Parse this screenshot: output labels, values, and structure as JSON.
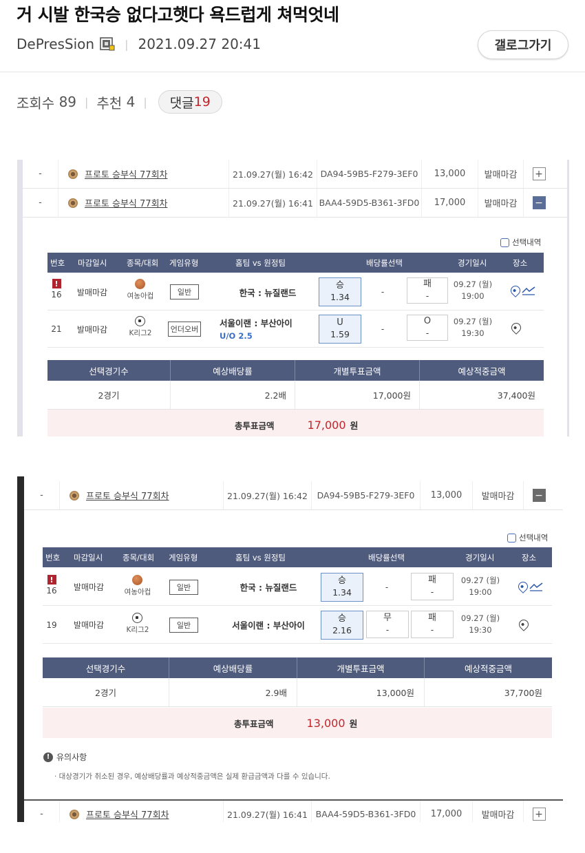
{
  "post": {
    "title": "거 시발 한국승 없다고햇다 욕드럽게 쳐먹엇네",
    "author": "DePresSion",
    "datetime": "2021.09.27 20:41",
    "gallery_button": "갤로그가기",
    "views_label": "조회수",
    "views": "89",
    "recommend_label": "추천",
    "recommend": "4",
    "comments_label": "댓글",
    "comments": "19"
  },
  "shot1": {
    "rows": [
      {
        "dash": "-",
        "name": "프로토 승부식 77회차",
        "date": "21.09.27(월) 16:42",
        "code": "DA94-59B5-F279-3EF0",
        "amount": "13,000",
        "status": "발매마감",
        "toggle": "+"
      },
      {
        "dash": "-",
        "name": "프로토 승부식 77회차",
        "date": "21.09.27(월) 16:41",
        "code": "BAA4-59D5-B361-3FD0",
        "amount": "17,000",
        "status": "발매마감",
        "toggle": "−"
      }
    ],
    "select_label": "선택내역",
    "headers": [
      "번호",
      "마감일시",
      "종목/대회",
      "게임유형",
      "홈팀 vs 원정팀",
      "배당률선택",
      "경기일시",
      "장소"
    ],
    "games": [
      {
        "alert": "!",
        "no": "16",
        "close": "발매마감",
        "league": "여농아컵",
        "type": "일반",
        "teams": "한국 : 뉴질랜드",
        "sub": "",
        "o1": "승",
        "o1v": "1.34",
        "mid": "-",
        "o3": "패",
        "o3v": "-",
        "gdate": "09.27 (월)",
        "gtime": "19:00"
      },
      {
        "alert": "",
        "no": "21",
        "close": "발매마감",
        "league": "K리그2",
        "type": "언더오버",
        "teams": "서울이랜 : 부산아이",
        "sub": "U/O 2.5",
        "o1": "U",
        "o1v": "1.59",
        "mid": "-",
        "o3": "O",
        "o3v": "-",
        "gdate": "09.27 (월)",
        "gtime": "19:30"
      }
    ],
    "sum_headers": [
      "선택경기수",
      "예상배당률",
      "개별투표금액",
      "예상적중금액"
    ],
    "sum_values": [
      "2경기",
      "2.2배",
      "17,000원",
      "37,400원"
    ],
    "total_label": "총투표금액",
    "total_value": "17,000",
    "total_unit": "원"
  },
  "shot2": {
    "top_row": {
      "dash": "-",
      "name": "프로토 승부식 77회차",
      "date": "21.09.27(월) 16:42",
      "code": "DA94-59B5-F279-3EF0",
      "amount": "13,000",
      "status": "발매마감",
      "toggle": "−"
    },
    "select_label": "선택내역",
    "headers": [
      "번호",
      "마감일시",
      "종목/대회",
      "게임유형",
      "홈팀 vs 원정팀",
      "배당률선택",
      "경기일시",
      "장소"
    ],
    "games": [
      {
        "alert": "!",
        "no": "16",
        "close": "발매마감",
        "league": "여농아컵",
        "type": "일반",
        "teams": "한국 : 뉴질랜드",
        "o1": "승",
        "o1v": "1.34",
        "mid": "-",
        "midv": "",
        "o3": "패",
        "o3v": "-",
        "gdate": "09.27 (월)",
        "gtime": "19:00"
      },
      {
        "alert": "",
        "no": "19",
        "close": "발매마감",
        "league": "K리그2",
        "type": "일반",
        "teams": "서울이랜 : 부산아이",
        "o1": "승",
        "o1v": "2.16",
        "mid": "무",
        "midv": "-",
        "o3": "패",
        "o3v": "-",
        "gdate": "09.27 (월)",
        "gtime": "19:30"
      }
    ],
    "sum_headers": [
      "선택경기수",
      "예상배당률",
      "개별투표금액",
      "예상적중금액"
    ],
    "sum_values": [
      "2경기",
      "2.9배",
      "13,000원",
      "37,700원"
    ],
    "total_label": "총투표금액",
    "total_value": "13,000",
    "total_unit": "원",
    "notice_title": "유의사항",
    "notice_text": "· 대상경기가 취소된 경우, 예상배당률과 예상적중금액은 실제 환급금액과 다를 수 있습니다.",
    "bottom_row": {
      "dash": "-",
      "name": "프로토 승부식 77회차",
      "date": "21.09.27(월) 16:41",
      "code": "BAA4-59D5-B361-3FD0",
      "amount": "17,000",
      "status": "발매마감",
      "toggle": "+"
    }
  },
  "colors": {
    "header_bg": "#4f5b7d",
    "accent_red": "#c0262c",
    "selected_odd_bg": "#eaf1fa",
    "total_bg": "#fbeff0"
  },
  "icons": [
    "level-icon",
    "coin-icon",
    "basketball-icon",
    "soccer-ball-icon",
    "location-pin-icon",
    "chart-icon",
    "alert-icon",
    "info-icon",
    "checkbox-icon"
  ]
}
